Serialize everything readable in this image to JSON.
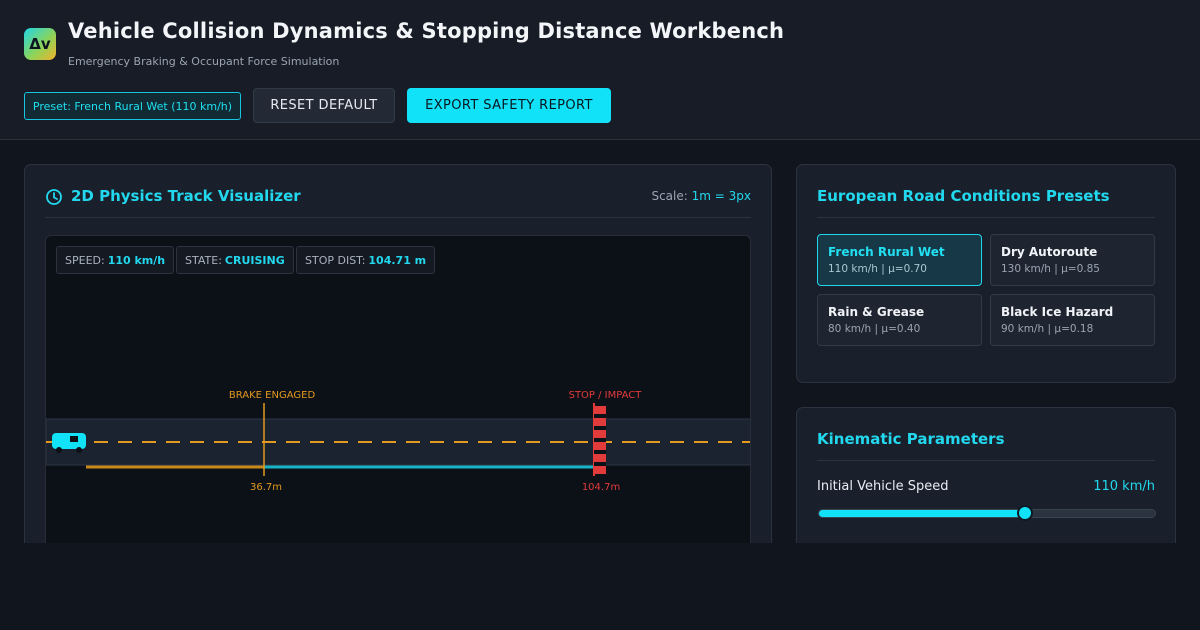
{
  "header": {
    "logo_text": "Δv",
    "title": "Vehicle Collision Dynamics & Stopping Distance Workbench",
    "subtitle": "Emergency Braking & Occupant Force Simulation",
    "preset_badge": "Preset: French Rural Wet (110 km/h)",
    "reset_label": "RESET DEFAULT",
    "export_label": "EXPORT SAFETY REPORT"
  },
  "track": {
    "title": "2D Physics Track Visualizer",
    "scale_label": "Scale:",
    "scale_value": "1m = 3px",
    "stats": {
      "speed_label": "SPEED:",
      "speed_value": "110 km/h",
      "state_label": "STATE:",
      "state_value": "CRUISING",
      "stop_label": "STOP DIST:",
      "stop_value": "104.71 m"
    },
    "brake_marker_label": "BRAKE ENGAGED",
    "stop_marker_label": "STOP / IMPACT",
    "brake_distance_label": "36.7m",
    "stop_distance_label": "104.7m",
    "brake_distance_m": 36.7,
    "stop_distance_m": 104.7,
    "icons": {
      "title": "clock-icon",
      "vehicle": "car-icon"
    },
    "colors": {
      "reaction": "#c98a1a",
      "braking": "#17b3c6",
      "brake_marker": "#e39a1e",
      "stop_marker": "#e23b3b",
      "lane": "#e39a1e"
    }
  },
  "presets": {
    "title": "European Road Conditions Presets",
    "items": [
      {
        "name": "French Rural Wet",
        "meta": "110 km/h | μ=0.70",
        "active": true
      },
      {
        "name": "Dry Autoroute",
        "meta": "130 km/h | μ=0.85",
        "active": false
      },
      {
        "name": "Rain & Grease",
        "meta": "80 km/h | μ=0.40",
        "active": false
      },
      {
        "name": "Black Ice Hazard",
        "meta": "90 km/h | μ=0.18",
        "active": false
      }
    ]
  },
  "kinematics": {
    "title": "Kinematic Parameters",
    "speed_label": "Initial Vehicle Speed",
    "speed_value": "110 km/h",
    "speed_fraction": 0.61
  }
}
